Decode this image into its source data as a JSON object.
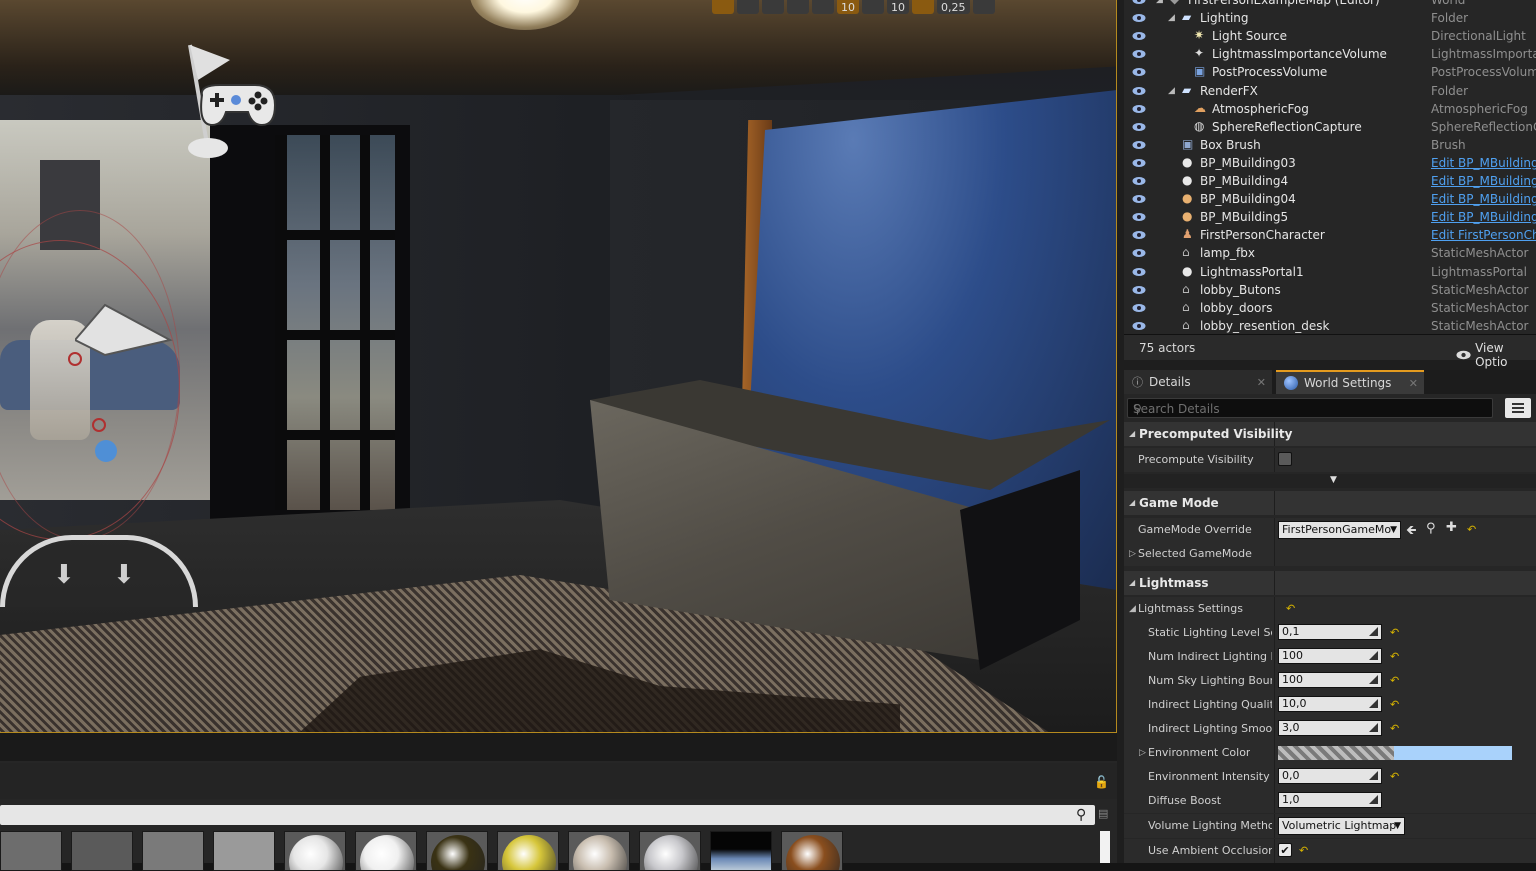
{
  "viewport": {
    "toolbar": [
      "",
      "",
      "",
      "",
      "",
      "10",
      "",
      "10",
      "",
      "0,25",
      ""
    ]
  },
  "outliner": {
    "rows": [
      {
        "label": "FirstPersonExampleMap (Editor)",
        "type": "World",
        "indent": 0,
        "arrow": "down",
        "icon": "world-icon",
        "link": false
      },
      {
        "label": "Lighting",
        "type": "Folder",
        "indent": 1,
        "arrow": "down",
        "icon": "folder-icon",
        "link": false
      },
      {
        "label": "Light Source",
        "type": "DirectionalLight",
        "indent": 2,
        "arrow": "",
        "icon": "directional-light-icon",
        "link": false
      },
      {
        "label": "LightmassImportanceVolume",
        "type": "LightmassImportan",
        "indent": 2,
        "arrow": "",
        "icon": "volume-icon",
        "link": false
      },
      {
        "label": "PostProcessVolume",
        "type": "PostProcessVolum",
        "indent": 2,
        "arrow": "",
        "icon": "postprocess-icon",
        "link": false
      },
      {
        "label": "RenderFX",
        "type": "Folder",
        "indent": 1,
        "arrow": "down",
        "icon": "folder-icon",
        "link": false
      },
      {
        "label": "AtmosphericFog",
        "type": "AtmosphericFog",
        "indent": 2,
        "arrow": "",
        "icon": "fog-icon",
        "link": false
      },
      {
        "label": "SphereReflectionCapture",
        "type": "SphereReflectionCa",
        "indent": 2,
        "arrow": "",
        "icon": "reflection-capture-icon",
        "link": false
      },
      {
        "label": "Box Brush",
        "type": "Brush",
        "indent": 1,
        "arrow": "",
        "icon": "brush-icon",
        "link": false
      },
      {
        "label": "BP_MBuilding03",
        "type": "Edit BP_MBuilding",
        "indent": 1,
        "arrow": "",
        "icon": "actor-sphere-icon",
        "link": true
      },
      {
        "label": "BP_MBuilding4",
        "type": "Edit BP_MBuilding",
        "indent": 1,
        "arrow": "",
        "icon": "actor-sphere-icon",
        "link": true
      },
      {
        "label": "BP_MBuilding04",
        "type": "Edit BP_MBuilding",
        "indent": 1,
        "arrow": "",
        "icon": "actor-sphere-orange-icon",
        "link": true
      },
      {
        "label": "BP_MBuilding5",
        "type": "Edit BP_MBuilding",
        "indent": 1,
        "arrow": "",
        "icon": "actor-sphere-orange-icon",
        "link": true
      },
      {
        "label": "FirstPersonCharacter",
        "type": "Edit FirstPersonCh",
        "indent": 1,
        "arrow": "",
        "icon": "character-icon",
        "link": true
      },
      {
        "label": "lamp_fbx",
        "type": "StaticMeshActor",
        "indent": 1,
        "arrow": "",
        "icon": "static-mesh-icon",
        "link": false
      },
      {
        "label": "LightmassPortal1",
        "type": "LightmassPortal",
        "indent": 1,
        "arrow": "",
        "icon": "actor-sphere-icon",
        "link": false
      },
      {
        "label": "lobby_Butons",
        "type": "StaticMeshActor",
        "indent": 1,
        "arrow": "",
        "icon": "static-mesh-icon",
        "link": false
      },
      {
        "label": "lobby_doors",
        "type": "StaticMeshActor",
        "indent": 1,
        "arrow": "",
        "icon": "static-mesh-icon",
        "link": false
      },
      {
        "label": "lobby_resention_desk",
        "type": "StaticMeshActor",
        "indent": 1,
        "arrow": "",
        "icon": "static-mesh-icon",
        "link": false
      }
    ],
    "actor_count": "75 actors",
    "view_options": "View Optio"
  },
  "tabs": {
    "details": "Details",
    "world_settings": "World Settings"
  },
  "details": {
    "search_placeholder": "Search Details",
    "categories": {
      "precomputed": "Precomputed Visibility",
      "game_mode": "Game Mode",
      "lightmass": "Lightmass"
    },
    "precompute_visibility": {
      "label": "Precompute Visibility",
      "checked": false
    },
    "gamemode_override": {
      "label": "GameMode Override",
      "value": "FirstPersonGameMo"
    },
    "selected_gamemode": "Selected GameMode",
    "lightmass_settings": "Lightmass Settings",
    "props": [
      {
        "label": "Static Lighting Level Sca",
        "value": "0,1"
      },
      {
        "label": "Num Indirect Lighting Bo",
        "value": "100"
      },
      {
        "label": "Num Sky Lighting Bounc",
        "value": "100"
      },
      {
        "label": "Indirect Lighting Quality",
        "value": "10,0"
      },
      {
        "label": "Indirect Lighting Smooth",
        "value": "3,0"
      }
    ],
    "environment_color": {
      "label": "Environment Color",
      "color": "#a9d2fb"
    },
    "environment_intensity": {
      "label": "Environment Intensity",
      "value": "0,0"
    },
    "diffuse_boost": {
      "label": "Diffuse Boost",
      "value": "1,0"
    },
    "volume_lighting_method": {
      "label": "Volume Lighting Method",
      "value": "Volumetric Lightmap"
    },
    "use_ambient_occlusion": {
      "label": "Use Ambient Occlusion",
      "checked": true
    }
  },
  "content_browser": {
    "thumbnails": [
      {
        "name": "thumb-1",
        "color": "#6d6d6d"
      },
      {
        "name": "thumb-2",
        "color": "#5a5a5a"
      },
      {
        "name": "thumb-3",
        "color": "#7a7a7a"
      },
      {
        "name": "thumb-4",
        "color": "#9a9a9a"
      },
      {
        "name": "thumb-white-sphere",
        "color": "#e6e6e6"
      },
      {
        "name": "thumb-white-sphere-2",
        "color": "#f0f0f0"
      },
      {
        "name": "thumb-dark-gold-sphere",
        "color": "#3a3214"
      },
      {
        "name": "thumb-gold-sphere",
        "color": "#d6c63a"
      },
      {
        "name": "thumb-marble-sphere",
        "color": "#c9beb0"
      },
      {
        "name": "thumb-grey-sphere",
        "color": "#c8c8cc"
      },
      {
        "name": "thumb-sky",
        "color": "#6a88b5"
      },
      {
        "name": "thumb-wood-sphere",
        "color": "#8a4e1e"
      }
    ]
  },
  "colors": {
    "accent": "#e49b1f",
    "link": "#4fa0f0",
    "reset": "#d8b400",
    "viewport_border": "#b58a1e"
  }
}
